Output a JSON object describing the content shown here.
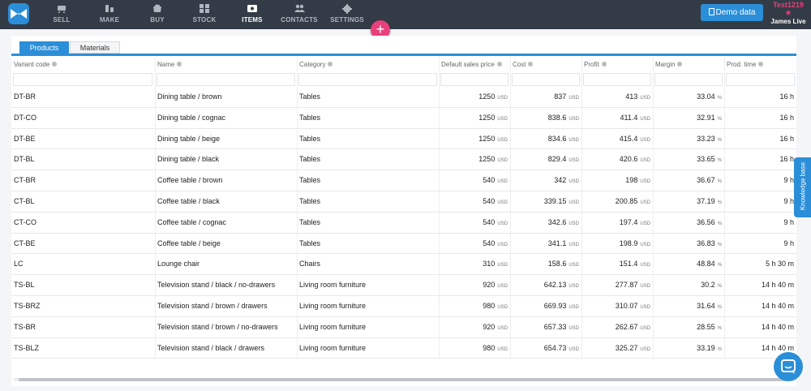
{
  "nav": [
    {
      "label": "SELL",
      "icon": "cart-icon",
      "active": false
    },
    {
      "label": "MAKE",
      "icon": "wrench-icon",
      "active": false
    },
    {
      "label": "BUY",
      "icon": "basket-icon",
      "active": false
    },
    {
      "label": "STOCK",
      "icon": "grid-icon",
      "active": false
    },
    {
      "label": "ITEMS",
      "icon": "tag-icon",
      "active": true
    },
    {
      "label": "CONTACTS",
      "icon": "people-icon",
      "active": false
    },
    {
      "label": "SETTINGS",
      "icon": "gear-icon",
      "active": false
    }
  ],
  "header": {
    "demo_label": "Demo data",
    "account": "Test1219",
    "user_name": "James Live"
  },
  "tabs": [
    "Products",
    "Materials"
  ],
  "columns": [
    "Variant code",
    "Name",
    "Category",
    "Default sales price",
    "Cost",
    "Profit",
    "Margin",
    "Prod. time"
  ],
  "currency": "USD",
  "percent": "%",
  "rows": [
    {
      "code": "DT-BR",
      "name": "Dining table / brown",
      "category": "Tables",
      "price": "1250",
      "cost": "837",
      "profit": "413",
      "margin": "33.04",
      "time": "16 h"
    },
    {
      "code": "DT-CO",
      "name": "Dining table / cognac",
      "category": "Tables",
      "price": "1250",
      "cost": "838.6",
      "profit": "411.4",
      "margin": "32.91",
      "time": "16 h"
    },
    {
      "code": "DT-BE",
      "name": "Dining table / beige",
      "category": "Tables",
      "price": "1250",
      "cost": "834.6",
      "profit": "415.4",
      "margin": "33.23",
      "time": "16 h"
    },
    {
      "code": "DT-BL",
      "name": "Dining table / black",
      "category": "Tables",
      "price": "1250",
      "cost": "829.4",
      "profit": "420.6",
      "margin": "33.65",
      "time": "16 h"
    },
    {
      "code": "CT-BR",
      "name": "Coffee table / brown",
      "category": "Tables",
      "price": "540",
      "cost": "342",
      "profit": "198",
      "margin": "36.67",
      "time": "9 h"
    },
    {
      "code": "CT-BL",
      "name": "Coffee table / black",
      "category": "Tables",
      "price": "540",
      "cost": "339.15",
      "profit": "200.85",
      "margin": "37.19",
      "time": "9 h"
    },
    {
      "code": "CT-CO",
      "name": "Coffee table / cognac",
      "category": "Tables",
      "price": "540",
      "cost": "342.6",
      "profit": "197.4",
      "margin": "36.56",
      "time": "9 h"
    },
    {
      "code": "CT-BE",
      "name": "Coffee table / beige",
      "category": "Tables",
      "price": "540",
      "cost": "341.1",
      "profit": "198.9",
      "margin": "36.83",
      "time": "9 h"
    },
    {
      "code": "LC",
      "name": "Lounge chair",
      "category": "Chairs",
      "price": "310",
      "cost": "158.6",
      "profit": "151.4",
      "margin": "48.84",
      "time": "5 h 30 m"
    },
    {
      "code": "TS-BL",
      "name": "Television stand / black / no-drawers",
      "category": "Living room furniture",
      "price": "920",
      "cost": "642.13",
      "profit": "277.87",
      "margin": "30.2",
      "time": "14 h 40 m"
    },
    {
      "code": "TS-BRZ",
      "name": "Television stand / brown / drawers",
      "category": "Living room furniture",
      "price": "980",
      "cost": "669.93",
      "profit": "310.07",
      "margin": "31.64",
      "time": "14 h 40 m"
    },
    {
      "code": "TS-BR",
      "name": "Television stand / brown / no-drawers",
      "category": "Living room furniture",
      "price": "920",
      "cost": "657.33",
      "profit": "262.67",
      "margin": "28.55",
      "time": "14 h 40 m"
    },
    {
      "code": "TS-BLZ",
      "name": "Television stand / black / drawers",
      "category": "Living room furniture",
      "price": "980",
      "cost": "654.73",
      "profit": "325.27",
      "margin": "33.19",
      "time": "14 h 40 m"
    }
  ],
  "knowledge_base": "Knowledge base",
  "colors": {
    "topbar": "#333c46",
    "accent": "#2b8ed8",
    "pink": "#e8407b"
  }
}
